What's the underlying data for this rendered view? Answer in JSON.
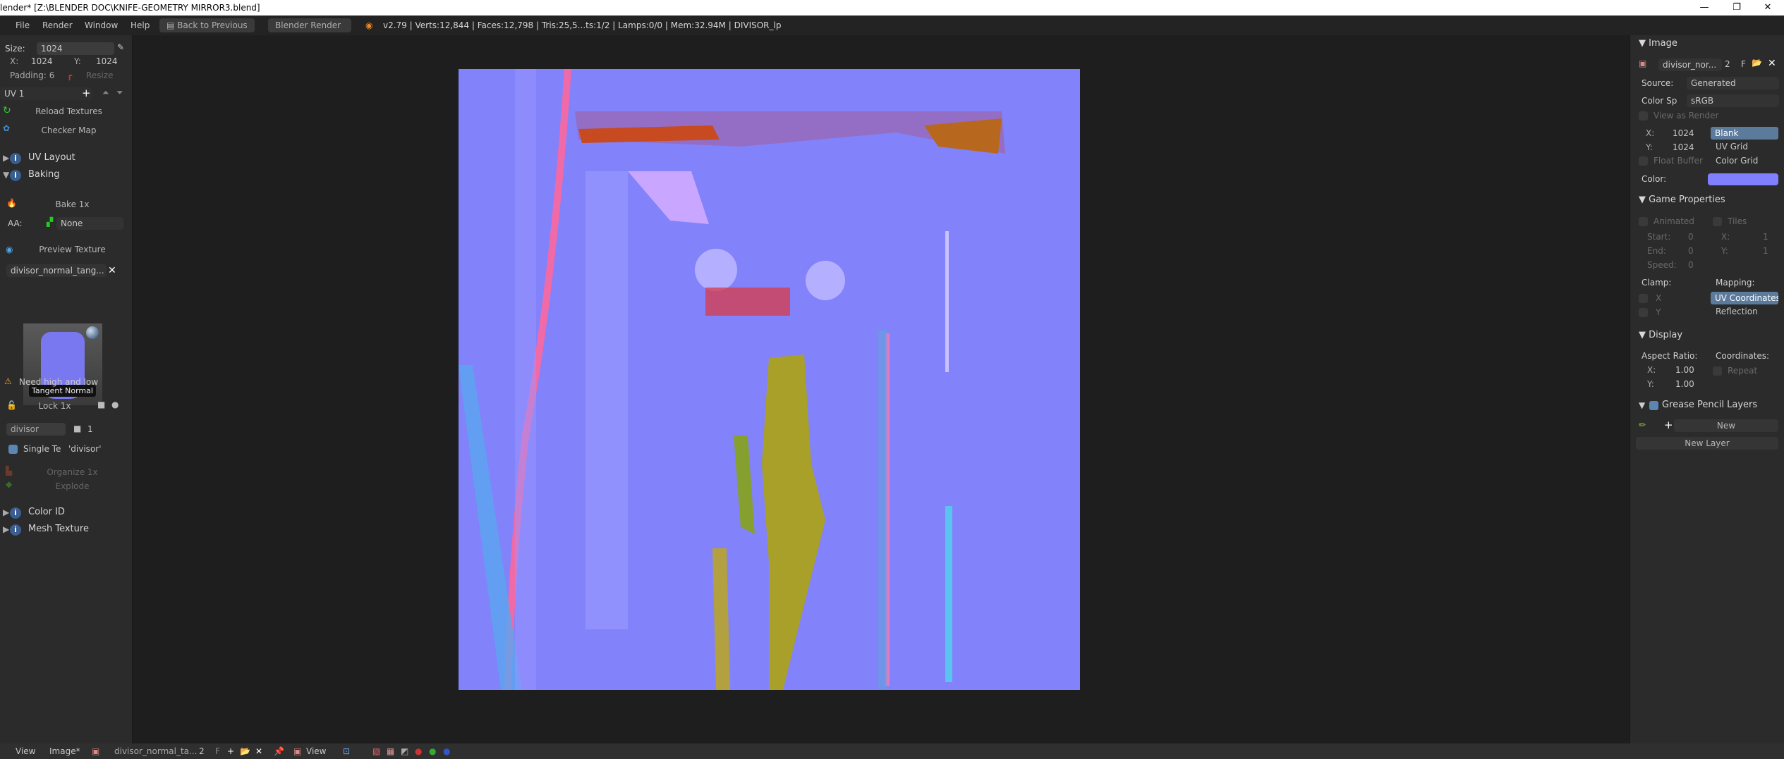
{
  "window": {
    "title": "lender* [Z:\\BLENDER DOC\\KNIFE-GEOMETRY MIRROR3.blend]",
    "min": "—",
    "max": "❐",
    "close": "✕"
  },
  "menubar": {
    "items": [
      "File",
      "Render",
      "Window",
      "Help"
    ],
    "back": "Back to Previous",
    "engine": "Blender Render",
    "stats": "v2.79 | Verts:12,844 | Faces:12,798 | Tris:25,5...ts:1/2 | Lamps:0/0 | Mem:32.94M | DIVISOR_lp"
  },
  "left": {
    "size_label": "Size:",
    "size_value": "1024",
    "x_label": "X:",
    "x_value": "1024",
    "y_label": "Y:",
    "y_value": "1024",
    "padding": "Padding: 6",
    "resize": "Resize",
    "uv": "UV 1",
    "reload": "Reload Textures",
    "checker": "Checker Map",
    "uv_layout": "UV Layout",
    "baking": "Baking",
    "bake": "Bake 1x",
    "aa_label": "AA:",
    "aa_value": "None",
    "preview": "Preview Texture",
    "texture_name": "divisor_normal_tang...",
    "thumb_label": "Tangent Normal",
    "warning": "Need high and low",
    "lock": "Lock 1x",
    "object": "divisor",
    "count": "1",
    "single": "Single Te",
    "single_value": "'divisor'",
    "organize": "Organize 1x",
    "explode": "Explode",
    "color_id": "Color ID",
    "mesh_texture": "Mesh Texture"
  },
  "right": {
    "image_header": "Image",
    "image_name": "divisor_nor...",
    "users": "2",
    "fake": "F",
    "source_label": "Source:",
    "source_value": "Generated",
    "colorsp_label": "Color Sp",
    "colorsp_value": "sRGB",
    "view_as_render": "View as Render",
    "x_label": "X:",
    "x_value": "1024",
    "y_label": "Y:",
    "y_value": "1024",
    "gen_types": [
      "Blank",
      "UV Grid",
      "Color Grid"
    ],
    "float_buffer": "Float Buffer",
    "color_label": "Color:",
    "color_value": "#8080ff",
    "game_header": "Game Properties",
    "animated": "Animated",
    "tiles": "Tiles",
    "start_label": "Start:",
    "start_value": "0",
    "end_label": "End:",
    "end_value": "0",
    "speed_label": "Speed:",
    "speed_value": "0",
    "tx_label": "X:",
    "tx_value": "1",
    "ty_label": "Y:",
    "ty_value": "1",
    "clamp": "Clamp:",
    "clamp_x": "X",
    "clamp_y": "Y",
    "mapping": "Mapping:",
    "mapping_options": [
      "UV Coordinates",
      "Reflection"
    ],
    "display_header": "Display",
    "aspect": "Aspect Ratio:",
    "ax_label": "X:",
    "ax_value": "1.00",
    "ay_label": "Y:",
    "ay_value": "1.00",
    "coordinates": "Coordinates:",
    "repeat": "Repeat",
    "gp_header": "Grease Pencil Layers",
    "new": "New",
    "new_layer": "New Layer"
  },
  "bottom": {
    "view": "View",
    "image": "Image*",
    "image_name": "divisor_normal_ta...",
    "users": "2",
    "fake": "F",
    "view_mode": "View"
  }
}
